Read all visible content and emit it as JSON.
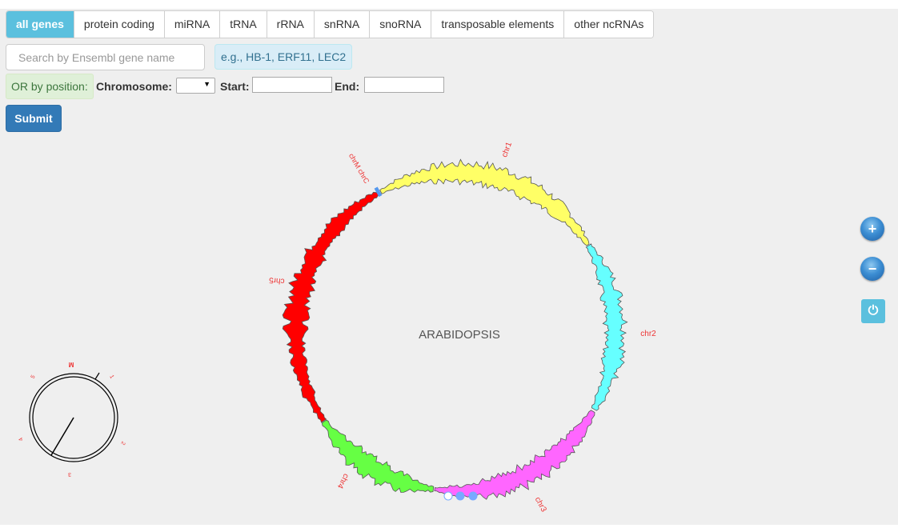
{
  "tabs": [
    {
      "label": "all genes",
      "active": true
    },
    {
      "label": "protein coding"
    },
    {
      "label": "miRNA"
    },
    {
      "label": "tRNA"
    },
    {
      "label": "rRNA"
    },
    {
      "label": "snRNA"
    },
    {
      "label": "snoRNA"
    },
    {
      "label": "transposable elements"
    },
    {
      "label": "other ncRNAs"
    }
  ],
  "search": {
    "placeholder": "Search by Ensembl gene name",
    "hint": "e.g., HB-1, ERF11, LEC2"
  },
  "position": {
    "or_label": "OR by position:",
    "chromosome_label": "Chromosome:",
    "chromosome_value": "",
    "start_label": "Start:",
    "end_label": "End:"
  },
  "submit_label": "Submit",
  "genome": {
    "center_label": "ARABIDOPSIS",
    "chromosomes": [
      {
        "name": "chr1",
        "color": "#ffff66"
      },
      {
        "name": "chr2",
        "color": "#66ffff"
      },
      {
        "name": "chr3",
        "color": "#ff66ff"
      },
      {
        "name": "chr4",
        "color": "#66ff44"
      },
      {
        "name": "chr5",
        "color": "#ff0000"
      }
    ],
    "other_labels": [
      "chrM",
      "chrC"
    ],
    "accent": "#5599ee"
  },
  "minimap": {
    "ticks": [
      "M",
      "1",
      "2",
      "3",
      "4",
      "5"
    ]
  },
  "controls": {
    "zoom_in_icon": "plus-circle-icon",
    "zoom_out_icon": "minus-circle-icon",
    "reset_icon": "power-icon"
  }
}
